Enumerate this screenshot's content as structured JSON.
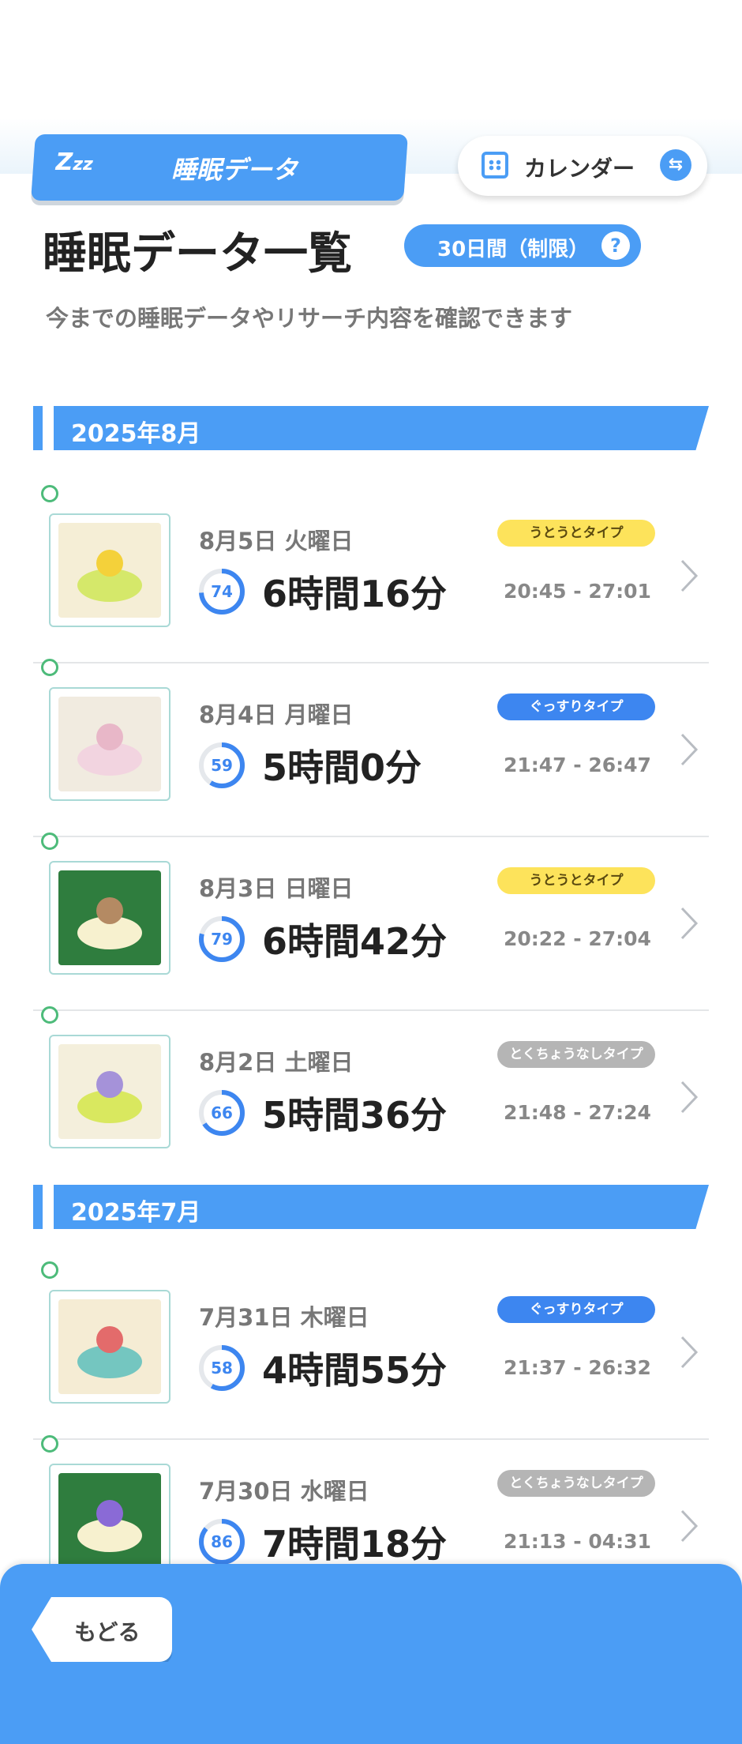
{
  "header": {
    "tab_label": "睡眠データ",
    "zzz": "Z",
    "zzz_small": "zz",
    "calendar_label": "カレンダー"
  },
  "page": {
    "title": "睡眠データ一覧",
    "limit_badge": "30日間（制限）",
    "help": "?",
    "subtitle": "今までの睡眠データやリサーチ内容を確認できます"
  },
  "months": [
    {
      "label": "2025年8月",
      "entries": [
        {
          "date": "8月5日 火曜日",
          "type": "うとうとタイプ",
          "type_color": "yellow",
          "score": "74",
          "duration": "6時間16分",
          "time": "20:45 - 27:01"
        },
        {
          "date": "8月4日 月曜日",
          "type": "ぐっすりタイプ",
          "type_color": "blue",
          "score": "59",
          "duration": "5時間0分",
          "time": "21:47 - 26:47"
        },
        {
          "date": "8月3日 日曜日",
          "type": "うとうとタイプ",
          "type_color": "yellow",
          "score": "79",
          "duration": "6時間42分",
          "time": "20:22 - 27:04"
        },
        {
          "date": "8月2日 土曜日",
          "type": "とくちょうなしタイプ",
          "type_color": "gray",
          "score": "66",
          "duration": "5時間36分",
          "time": "21:48 - 27:24"
        }
      ]
    },
    {
      "label": "2025年7月",
      "entries": [
        {
          "date": "7月31日 木曜日",
          "type": "ぐっすりタイプ",
          "type_color": "blue",
          "score": "58",
          "duration": "4時間55分",
          "time": "21:37 - 26:32"
        },
        {
          "date": "7月30日 水曜日",
          "type": "とくちょうなしタイプ",
          "type_color": "gray",
          "score": "86",
          "duration": "7時間18分",
          "time": "21:13 - 04:31"
        }
      ]
    }
  ],
  "footer": {
    "back_label": "もどる"
  },
  "colors": {
    "accent": "#4b9df5",
    "badge_blue": "#3d86f0",
    "badge_yellow": "#fde35b",
    "badge_gray": "#b5b5b5"
  }
}
